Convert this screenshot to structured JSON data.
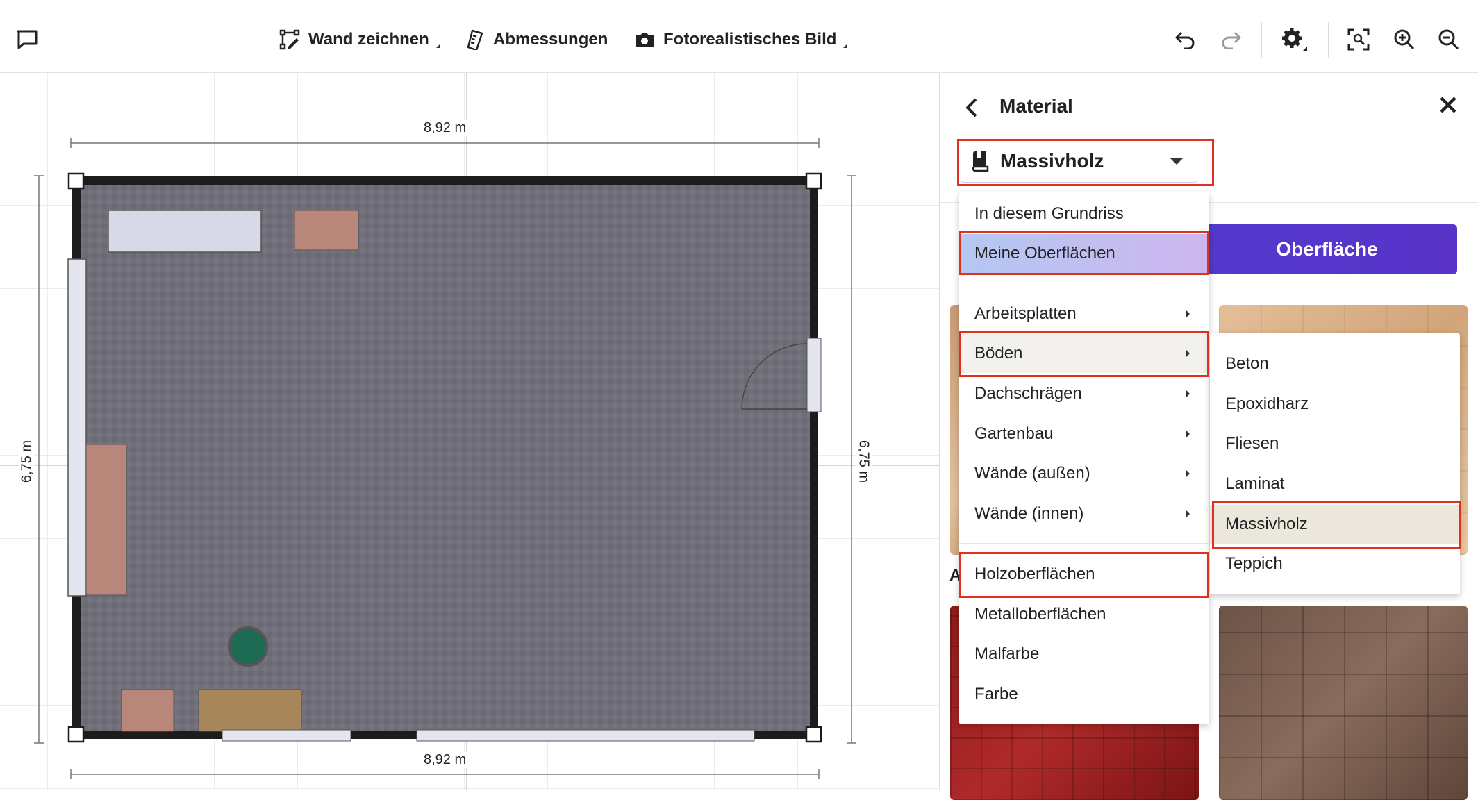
{
  "toolbar": {
    "draw_wall": "Wand zeichnen",
    "dimensions": "Abmessungen",
    "photo": "Fotorealistisches Bild"
  },
  "plan": {
    "dim_top": "8,92 m",
    "dim_bottom": "8,92 m",
    "dim_left": "6,75 m",
    "dim_right": "6,75 m"
  },
  "panel": {
    "title": "Material",
    "selected": "Massivholz",
    "cta_label": "Oberfläche",
    "section_letter": "A"
  },
  "menu": {
    "items": [
      {
        "label": "In diesem Grundriss"
      },
      {
        "label": "Meine Oberflächen"
      },
      {
        "label": "Arbeitsplatten"
      },
      {
        "label": "Böden"
      },
      {
        "label": "Dachschrägen"
      },
      {
        "label": "Gartenbau"
      },
      {
        "label": "Wände (außen)"
      },
      {
        "label": "Wände (innen)"
      },
      {
        "label": "Holzoberflächen"
      },
      {
        "label": "Metalloberflächen"
      },
      {
        "label": "Malfarbe"
      },
      {
        "label": "Farbe"
      }
    ]
  },
  "submenu": {
    "items": [
      {
        "label": "Beton"
      },
      {
        "label": "Epoxidharz"
      },
      {
        "label": "Fliesen"
      },
      {
        "label": "Laminat"
      },
      {
        "label": "Massivholz"
      },
      {
        "label": "Teppich"
      }
    ]
  },
  "colors": {
    "highlight_border": "#e0301e",
    "cta": "#4b3fd0",
    "floor": "#6f6e78"
  }
}
